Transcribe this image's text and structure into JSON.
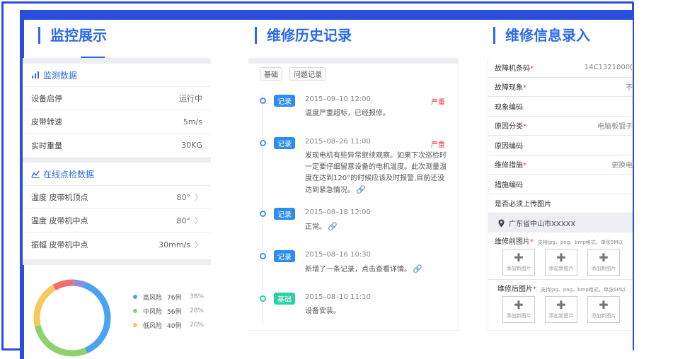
{
  "monitor": {
    "title": "监控展示",
    "section1_title": "监测数据",
    "rows1": [
      {
        "label": "设备启停",
        "value": "运行中"
      },
      {
        "label": "皮带转速",
        "value": "5m/s"
      },
      {
        "label": "实时重量",
        "value": "30KG"
      }
    ],
    "section2_title": "在线点检数据",
    "rows2": [
      {
        "label": "温度  皮带机顶点",
        "value": "80°"
      },
      {
        "label": "温度  皮带机中点",
        "value": "80°"
      },
      {
        "label": "振幅  皮带机中点",
        "value": "30mm/s"
      }
    ],
    "chevron": "〉",
    "legend": [
      {
        "name": "高风险",
        "count": "76例",
        "pct": "38%",
        "color": "#4aa3f0"
      },
      {
        "name": "中风险",
        "count": "56例",
        "pct": "28%",
        "color": "#8fd26a"
      },
      {
        "name": "低风险",
        "count": "40例",
        "pct": "20%",
        "color": "#f7c85c"
      }
    ],
    "ring_colors": [
      "#4aa3f0",
      "#8fd26a",
      "#f7c85c",
      "#f06e6e",
      "#8a8de6"
    ],
    "ring_values": [
      38,
      28,
      20,
      9,
      5
    ]
  },
  "history": {
    "title": "维修历史记录",
    "tabs": [
      "基础",
      "问题记录"
    ],
    "items": [
      {
        "badge": "记录",
        "time": "2015–09–10 12:00",
        "level": "严重",
        "desc": "温度严重超标，已经报修。",
        "attach": false
      },
      {
        "badge": "记录",
        "time": "2015–08–26 11:00",
        "level": "严重",
        "desc": "发现电机有些异常继续观察。如果下次巡检时一定要仔细留意设备的电机温度。此次测量温度在达到120°的时候应该及时报警,目前还没达到紧急情况。",
        "attach": true
      },
      {
        "badge": "记录",
        "time": "2015–08–18 12:00",
        "level": "",
        "desc": "正常。",
        "attach": true
      },
      {
        "badge": "记录",
        "time": "2015–08–16 10:30",
        "level": "",
        "desc": "新增了一条记录，点击查看详情。",
        "attach": true
      },
      {
        "badge": "基础",
        "time": "2015–08–10 11:10",
        "level": "",
        "desc": "设备安装。",
        "attach": false
      }
    ],
    "clip_glyph": "🔗"
  },
  "entry": {
    "title": "维修信息录入",
    "fields": [
      {
        "label": "故障机条码",
        "required": true,
        "value": "14C1321000("
      },
      {
        "label": "故障现象",
        "required": true,
        "value": "不"
      },
      {
        "label": "现象编码",
        "required": false,
        "value": ""
      },
      {
        "label": "原因分类",
        "required": true,
        "value": "电脑板锢子"
      },
      {
        "label": "原因编码",
        "required": false,
        "value": ""
      },
      {
        "label": "维修措施",
        "required": true,
        "value": "更换电"
      },
      {
        "label": "措施编码",
        "required": false,
        "value": ""
      },
      {
        "label": "是否必须上传图片",
        "required": false,
        "value": ""
      }
    ],
    "location": "广东省中山市XXXXX",
    "before_label": "维修前图片",
    "after_label": "维修后图片",
    "upload_hint": "支持jpg、png、bmp格式，单张5M以",
    "tile_label": "添加新图片",
    "required_mark": "*"
  }
}
